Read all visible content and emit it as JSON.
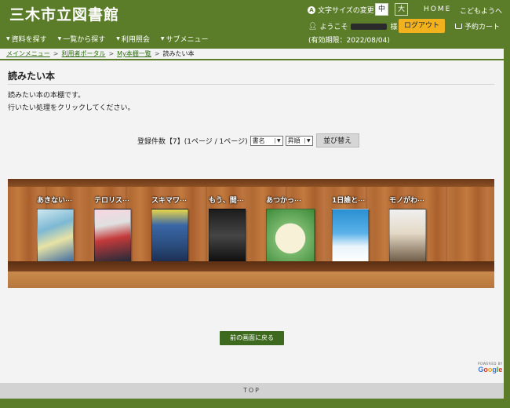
{
  "header": {
    "site_title": "三木市立図書館",
    "font_size_label": "文字サイズの変更",
    "font_size_mid": "中",
    "font_size_large": "大",
    "home": "HOME",
    "kids": "こどもようへ",
    "welcome_prefix": "ようこそ",
    "welcome_suffix": "様",
    "logout": "ログアウト",
    "cart": "予約カート",
    "expiry": "(有効期限：2022/08/04)"
  },
  "nav": {
    "items": [
      {
        "label": "資料を探す"
      },
      {
        "label": "一覧から探す"
      },
      {
        "label": "利用照会"
      },
      {
        "label": "サブメニュー"
      }
    ]
  },
  "breadcrumb": {
    "items": [
      "メインメニュー",
      "利用者ポータル",
      "My本棚一覧",
      "読みたい本"
    ],
    "separator": ">"
  },
  "page": {
    "title": "読みたい本",
    "desc1": "読みたい本の本棚です。",
    "desc2": "行いたい処理をクリックしてください。"
  },
  "sortbar": {
    "count_text": "登録件数【7】(1ページ / 1ページ)",
    "field_selected": "書名",
    "order_selected": "昇順",
    "sort_button": "並び替え"
  },
  "books": [
    {
      "title": "あきない",
      "more": "･･･"
    },
    {
      "title": "テロリス",
      "more": "･･･"
    },
    {
      "title": "スキマワ",
      "more": "･･･"
    },
    {
      "title": "もう、間",
      "more": "･･･"
    },
    {
      "title": "あつかっ",
      "more": "･･･"
    },
    {
      "title": "1日誰と",
      "more": "･･･"
    },
    {
      "title": "モノがわ",
      "more": "･･･"
    }
  ],
  "back_button": "前の画面に戻る",
  "google": {
    "powered_by": "POWERED BY",
    "letters": [
      "G",
      "o",
      "o",
      "g",
      "l",
      "e"
    ]
  },
  "footer": {
    "top": "TOP"
  }
}
